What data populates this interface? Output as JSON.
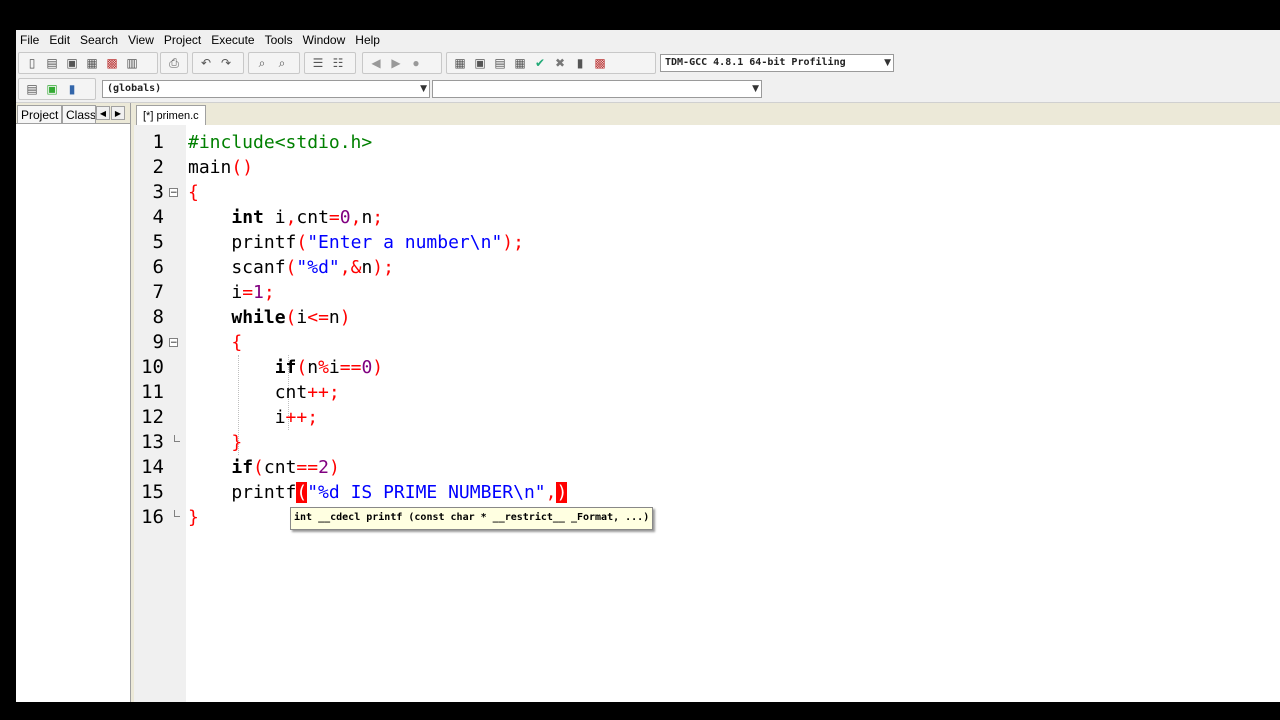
{
  "menu": [
    "File",
    "Edit",
    "Search",
    "View",
    "Project",
    "Execute",
    "Tools",
    "Window",
    "Help"
  ],
  "toolbar": {
    "compiler": "TDM-GCC 4.8.1 64-bit Profiling",
    "scope": "(globals)",
    "function": ""
  },
  "left_panel": {
    "tabs": [
      "Project",
      "Classe"
    ]
  },
  "editor": {
    "tab_label": "[*] primen.c",
    "line_numbers": [
      "1",
      "2",
      "3",
      "4",
      "5",
      "6",
      "7",
      "8",
      "9",
      "10",
      "11",
      "12",
      "13",
      "14",
      "15",
      "16"
    ],
    "lines": [
      "#include<stdio.h>",
      "main()",
      "{",
      "    int i,cnt=0,n;",
      "    printf(\"Enter a number\\n\");",
      "    scanf(\"%d\",&n);",
      "    i=1;",
      "    while(i<=n)",
      "    {",
      "        if(n%i==0)",
      "        cnt++;",
      "        i++;",
      "    }",
      "    if(cnt==2)",
      "    printf(\"%d IS PRIME NUMBER\\n\",)",
      "}"
    ],
    "tooltip": "int __cdecl printf (const char * __restrict__ _Format, ...)"
  },
  "colors": {
    "active_line": "#ccffff",
    "preprocessor": "#008000",
    "symbol": "#ff0000",
    "number": "#800080",
    "string": "#0000ff",
    "bracket_highlight": "#ff0000"
  }
}
